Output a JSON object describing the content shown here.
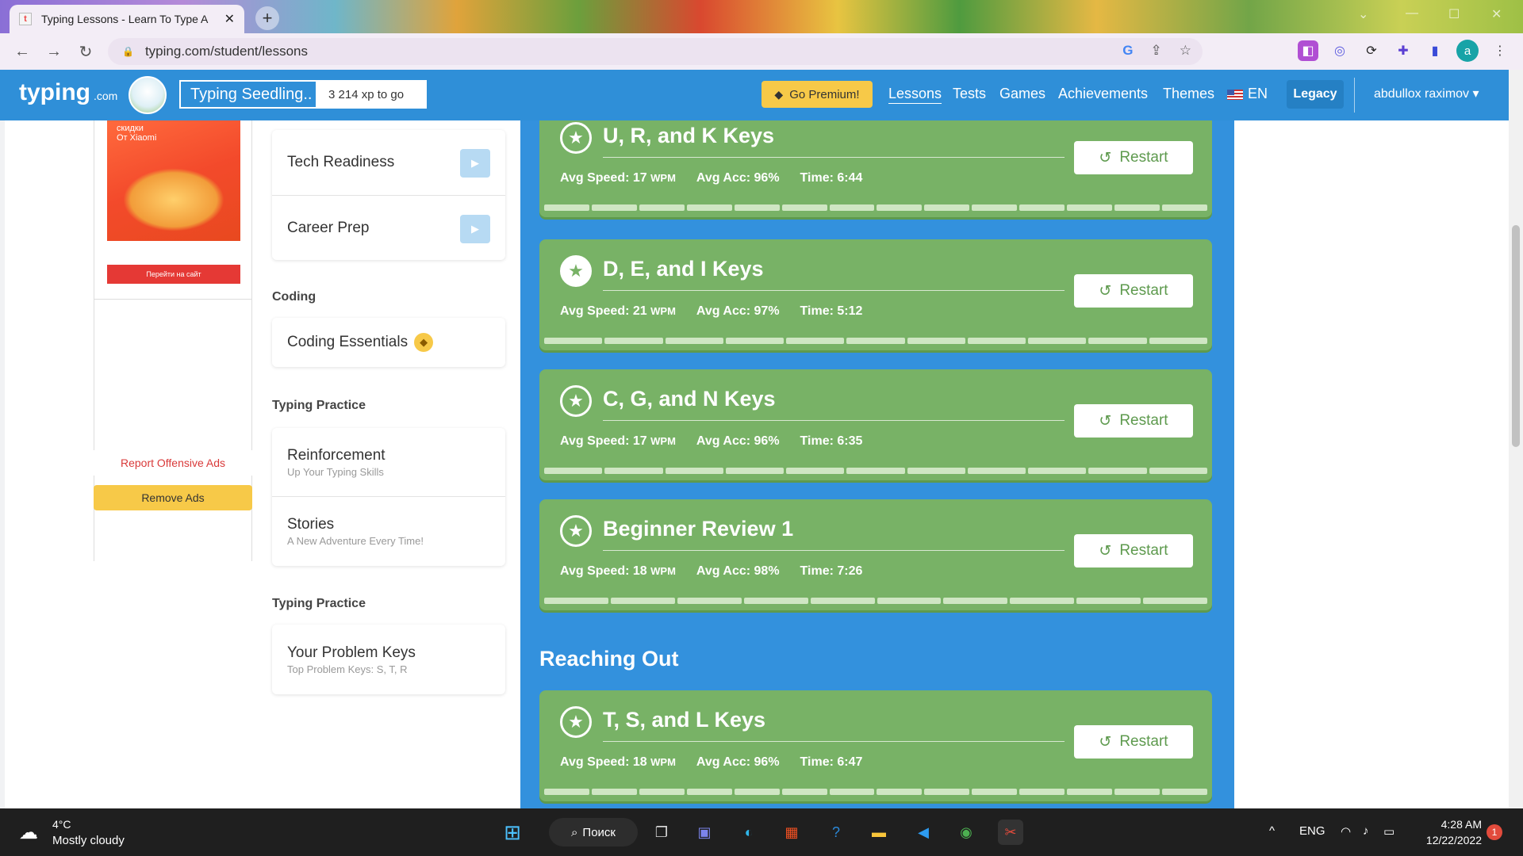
{
  "browser": {
    "tab_title": "Typing Lessons - Learn To Type A",
    "tab_favicon": "t",
    "url": "typing.com/student/lessons",
    "profile_initial": "a"
  },
  "header": {
    "logo": "typing",
    "logo_suffix": ".com",
    "level_name": "Typing Seedling..",
    "xp_to_go": "3 214 xp to go",
    "premium": "Go Premium!",
    "nav": [
      "Lessons",
      "Tests",
      "Games",
      "Achievements",
      "Themes"
    ],
    "language": "EN",
    "legacy": "Legacy",
    "user": "abdullox raximov"
  },
  "ads": {
    "ad_line1": "скидки",
    "ad_line2": "От Xiaomi",
    "ad_cta": "Перейти на сайт",
    "report": "Report Offensive Ads",
    "remove": "Remove Ads"
  },
  "sidebar": {
    "top_items": [
      {
        "name": "Tech Readiness"
      },
      {
        "name": "Career Prep"
      }
    ],
    "coding_label": "Coding",
    "coding_item": "Coding Essentials",
    "practice_label": "Typing Practice",
    "practice_items": [
      {
        "name": "Reinforcement",
        "sub": "Up Your Typing Skills"
      },
      {
        "name": "Stories",
        "sub": "A New Adventure Every Time!"
      }
    ],
    "practice_label2": "Typing Practice",
    "problem_keys": {
      "name": "Your Problem Keys",
      "sub": "Top Problem Keys: S, T, R"
    }
  },
  "lessons": [
    {
      "title": "U, R, and K Keys",
      "speed": "Avg Speed: 17",
      "acc": "Avg Acc: 96%",
      "time": "Time: 6:44",
      "segments": 14
    },
    {
      "title": "D, E, and I Keys",
      "speed": "Avg Speed: 21",
      "acc": "Avg Acc: 97%",
      "time": "Time: 5:12",
      "segments": 11
    },
    {
      "title": "C, G, and N Keys",
      "speed": "Avg Speed: 17",
      "acc": "Avg Acc: 96%",
      "time": "Time: 6:35",
      "segments": 11
    },
    {
      "title": "Beginner Review 1",
      "speed": "Avg Speed: 18",
      "acc": "Avg Acc: 98%",
      "time": "Time: 7:26",
      "segments": 10
    }
  ],
  "section2": {
    "title": "Reaching Out",
    "lesson": {
      "title": "T, S, and L Keys",
      "speed": "Avg Speed: 18",
      "acc": "Avg Acc: 96%",
      "time": "Time: 6:47",
      "segments": 14
    }
  },
  "wpm_unit": "WPM",
  "restart_label": "Restart",
  "taskbar": {
    "temp": "4°C",
    "weather": "Mostly cloudy",
    "search": "Поиск",
    "lang": "ENG",
    "time": "4:28 AM",
    "date": "12/22/2022",
    "notifications": "1"
  },
  "colors": {
    "header_blue": "#2f8fd8",
    "lesson_green": "#78b266",
    "premium_yellow": "#f7c948"
  }
}
